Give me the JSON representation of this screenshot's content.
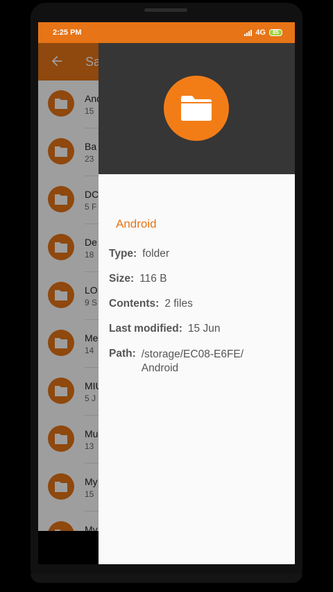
{
  "status_bar": {
    "time": "2:25 PM",
    "network": "4G",
    "battery": "85"
  },
  "app_bar": {
    "title": "Sa",
    "back_icon": "arrow-back-icon"
  },
  "folders": [
    {
      "name": "And",
      "meta": "15"
    },
    {
      "name": "Ba",
      "meta": "23"
    },
    {
      "name": "DC",
      "meta": "5 F"
    },
    {
      "name": "De",
      "meta": "18"
    },
    {
      "name": "LO",
      "meta": "9 S"
    },
    {
      "name": "Me",
      "meta": "14"
    },
    {
      "name": "MIU",
      "meta": "5 J"
    },
    {
      "name": "Mu",
      "meta": "13"
    },
    {
      "name": "My",
      "meta": "15"
    },
    {
      "name": "My",
      "meta": ""
    }
  ],
  "details": {
    "icon": "folder-icon",
    "name": "Android",
    "type_label": "Type:",
    "type_value": "folder",
    "size_label": "Size:",
    "size_value": "116 B",
    "contents_label": "Contents:",
    "contents_value": "2 files",
    "modified_label": "Last modified:",
    "modified_value": "15 Jun",
    "path_label": "Path:",
    "path_value": "/storage/EC08-E6FE/ Android"
  },
  "colors": {
    "accent": "#e77416",
    "header_dark": "#363636",
    "icon_orange": "#f27d17"
  }
}
